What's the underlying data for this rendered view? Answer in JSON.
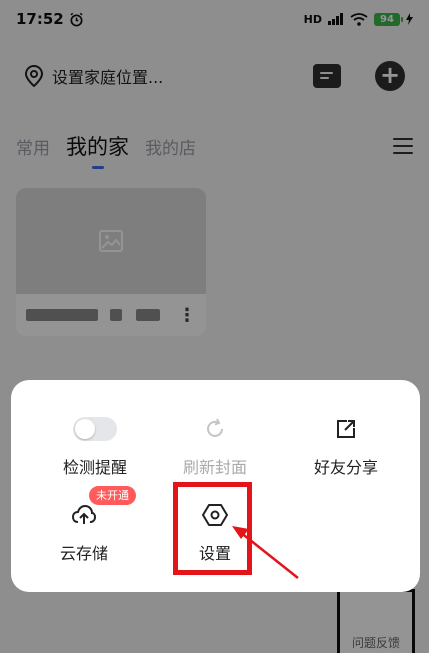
{
  "status_bar": {
    "time": "17:52",
    "network": "HD",
    "battery_level": "94"
  },
  "header": {
    "location_text": "设置家庭位置..."
  },
  "tabs": [
    {
      "label": "常用",
      "active": false
    },
    {
      "label": "我的家",
      "active": true
    },
    {
      "label": "我的店",
      "active": false
    }
  ],
  "feedback": {
    "label": "问题反馈"
  },
  "popup": {
    "items": [
      {
        "label": "检测提醒",
        "icon": "toggle-switch",
        "state": "off"
      },
      {
        "label": "刷新封面",
        "icon": "refresh-icon",
        "state": "disabled"
      },
      {
        "label": "好友分享",
        "icon": "share-icon"
      },
      {
        "label": "云存储",
        "icon": "cloud-upload-icon",
        "badge": "未开通"
      },
      {
        "label": "设置",
        "icon": "settings-icon"
      }
    ]
  },
  "colors": {
    "accent": "#3a6cf0",
    "badge": "#ff5b5b",
    "highlight": "#e3141a",
    "battery": "#3bb54a"
  }
}
